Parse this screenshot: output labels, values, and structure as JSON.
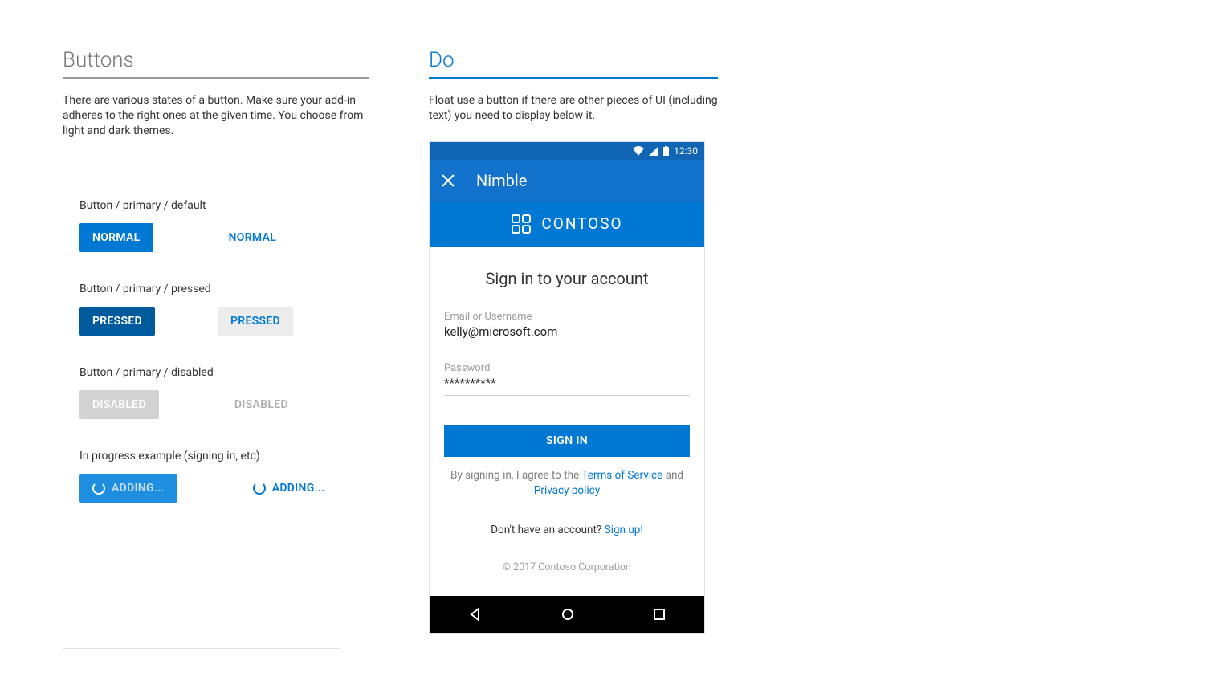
{
  "left": {
    "heading": "Buttons",
    "desc": "There are various states of a button. Make sure your add-in adheres to the right ones at the given time. You choose from light and dark themes.",
    "groups": [
      {
        "label": "Button / primary / default",
        "solid": "NORMAL",
        "flat": "NORMAL"
      },
      {
        "label": "Button / primary / pressed",
        "solid": "PRESSED",
        "flat": "PRESSED"
      },
      {
        "label": "Button / primary / disabled",
        "solid": "DISABLED",
        "flat": "DISABLED"
      },
      {
        "label": "In progress example (signing in, etc)",
        "solid": "ADDING...",
        "flat": "ADDING..."
      }
    ]
  },
  "right": {
    "heading": "Do",
    "desc": "Float use a button if there are other pieces of UI (including text) you need to display below it.",
    "statusbar": {
      "time": "12:30"
    },
    "appbar": {
      "title": "Nimble"
    },
    "brand": {
      "name": "CONTOSO"
    },
    "signin": {
      "title": "Sign in to your account",
      "email_label": "Email or Username",
      "email_value": "kelly@microsoft.com",
      "password_label": "Password",
      "password_value": "**********",
      "button": "SIGN IN",
      "legal_prefix": "By signing in, I agree to the ",
      "tos": "Terms of Service",
      "legal_mid": " and ",
      "privacy": "Privacy policy",
      "signup_prefix": "Don't have an account? ",
      "signup_link": "Sign up!",
      "copyright": "© 2017 Contoso Corporation"
    }
  }
}
